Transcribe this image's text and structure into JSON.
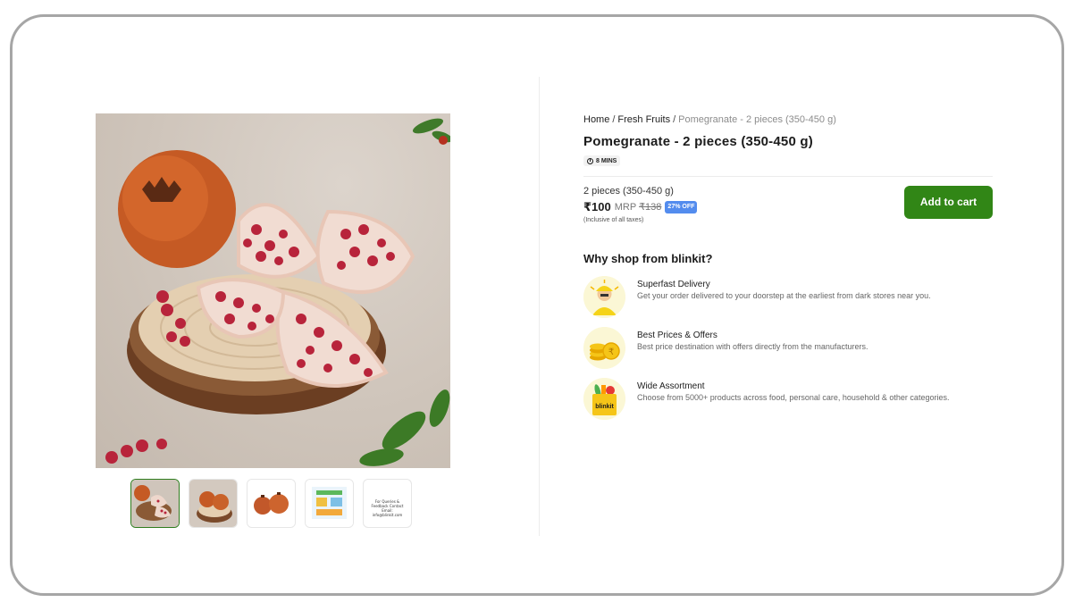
{
  "breadcrumb": {
    "home": "Home",
    "category": "Fresh Fruits",
    "current": "Pomegranate - 2 pieces (350-450 g)",
    "separator": "/"
  },
  "product": {
    "title": "Pomegranate - 2 pieces (350-450 g)",
    "eta": "8 MINS",
    "variant": "2 pieces (350-450 g)",
    "price": "₹100",
    "mrp_label": "MRP",
    "mrp_value": "₹138",
    "discount": "27% OFF",
    "tax_note": "(Inclusive of all taxes)",
    "add_to_cart": "Add to cart"
  },
  "gallery": {
    "thumbnail_count": 5,
    "active_index": 0,
    "thumb_5_text": "For Queries & Feedback Contact Email: info@blinkit.com"
  },
  "why_shop": {
    "title": "Why shop from blinkit?",
    "features": [
      {
        "title": "Superfast Delivery",
        "description": "Get your order delivered to your doorstep at the earliest from dark stores near you.",
        "icon": "delivery-person-icon"
      },
      {
        "title": "Best Prices & Offers",
        "description": "Best price destination with offers directly from the manufacturers.",
        "icon": "coins-icon"
      },
      {
        "title": "Wide Assortment",
        "description": "Choose from 5000+ products across food, personal care, household & other categories.",
        "icon": "grocery-bag-icon"
      }
    ],
    "bag_logo_text": "blinkit"
  },
  "colors": {
    "primary_button": "#318616",
    "discount_badge": "#538cee",
    "active_thumb_border": "#2f7d1f",
    "feature_icon_bg": "#fbf7d5"
  }
}
